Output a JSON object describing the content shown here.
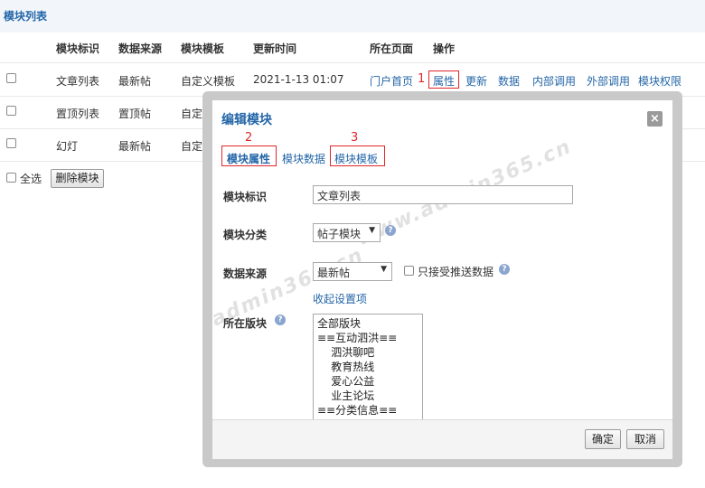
{
  "section_title": "模块列表",
  "table": {
    "headers": [
      "模块标识",
      "数据来源",
      "模块模板",
      "更新时间",
      "所在页面",
      "操作"
    ],
    "rows": [
      {
        "id": "文章列表",
        "source": "最新帖",
        "template": "自定义模板",
        "time": "2021-1-13 01:07",
        "page": "门户首页"
      },
      {
        "id": "置顶列表",
        "source": "置顶帖",
        "template": "自定",
        "time": "",
        "page": ""
      },
      {
        "id": "幻灯",
        "source": "最新帖",
        "template": "自定",
        "time": "",
        "page": ""
      }
    ],
    "actions": [
      "属性",
      "更新",
      "数据",
      "内部调用",
      "外部调用",
      "模块权限"
    ]
  },
  "bottom": {
    "select_all": "全选",
    "delete_button": "删除模块"
  },
  "annotations": [
    "1",
    "2",
    "3"
  ],
  "modal": {
    "title": "编辑模块",
    "close": "×",
    "tabs": [
      "模块属性",
      "模块数据",
      "模块模板"
    ],
    "fields": {
      "id_label": "模块标识",
      "id_value": "文章列表",
      "category_label": "模块分类",
      "category_value": "帖子模块",
      "source_label": "数据来源",
      "source_value": "最新帖",
      "push_only_label": "只接受推送数据",
      "collapse_link": "收起设置项",
      "board_label": "所在版块"
    },
    "board_options": [
      "全部版块",
      "≡≡互动泗洪≡≡",
      "    泗洪聊吧",
      "    教育热线",
      "    爱心公益",
      "    业主论坛",
      "≡≡分类信息≡≡"
    ],
    "confirm": "确定",
    "cancel": "取消"
  },
  "watermark": "www.admin365.cn",
  "colors": {
    "link": "#2366a8",
    "highlight": "#e0262a",
    "frame": "#c9c9c9"
  }
}
